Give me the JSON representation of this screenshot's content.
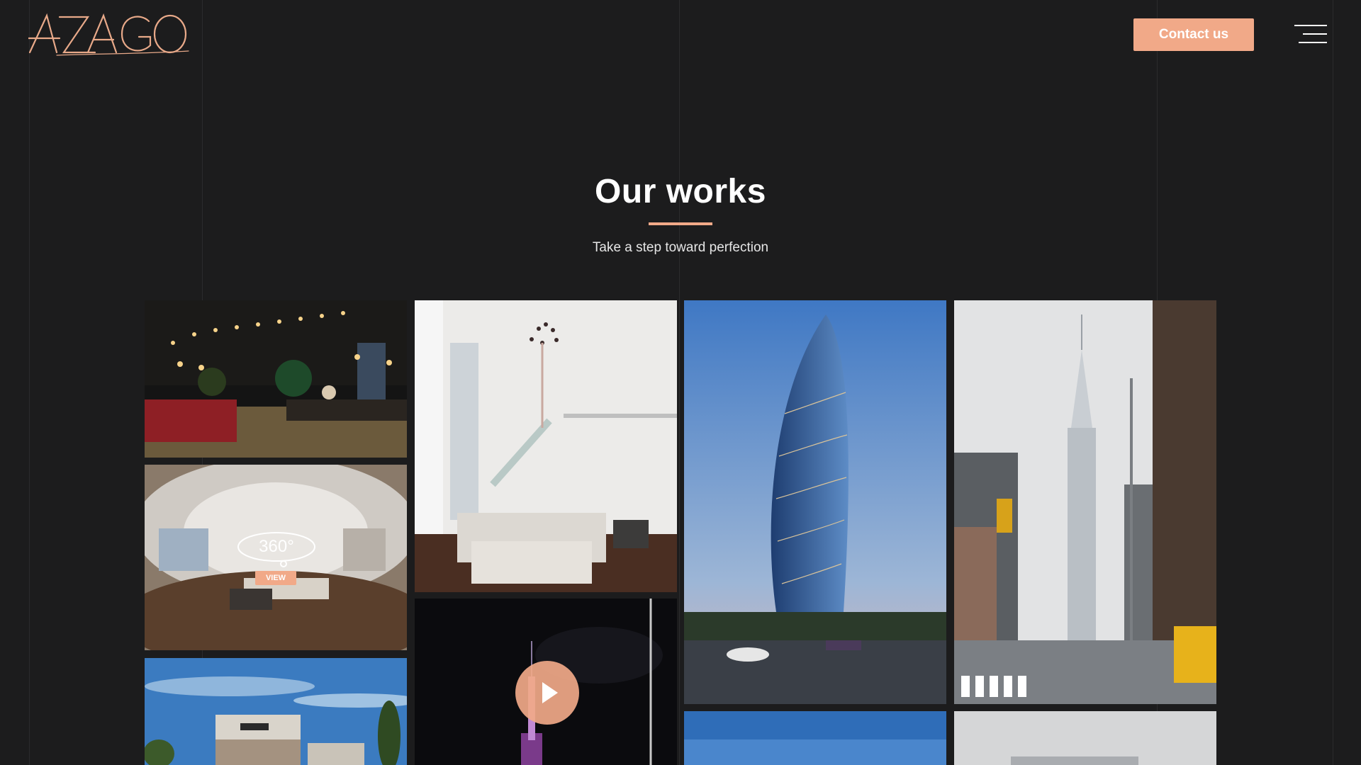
{
  "brand": {
    "logo_text": "AZAGO",
    "accent_color": "#f1a988",
    "background_color": "#1c1c1d"
  },
  "header": {
    "contact_label": "Contact us",
    "menu_icon": "hamburger-menu-icon"
  },
  "works": {
    "title": "Our works",
    "subtitle": "Take a step toward perfection",
    "gallery": [
      {
        "name": "bar-interior-render"
      },
      {
        "name": "living-room-360-tour",
        "badge": "VIEW",
        "tour_label": "360°"
      },
      {
        "name": "villa-exterior-render"
      },
      {
        "name": "duplex-living-room-render"
      },
      {
        "name": "night-skyscraper-video",
        "icon": "play-icon"
      },
      {
        "name": "glass-tower-render"
      },
      {
        "name": "sky-render-bottom"
      },
      {
        "name": "new-york-street-render"
      },
      {
        "name": "cloudy-sky-render-bottom"
      }
    ]
  }
}
